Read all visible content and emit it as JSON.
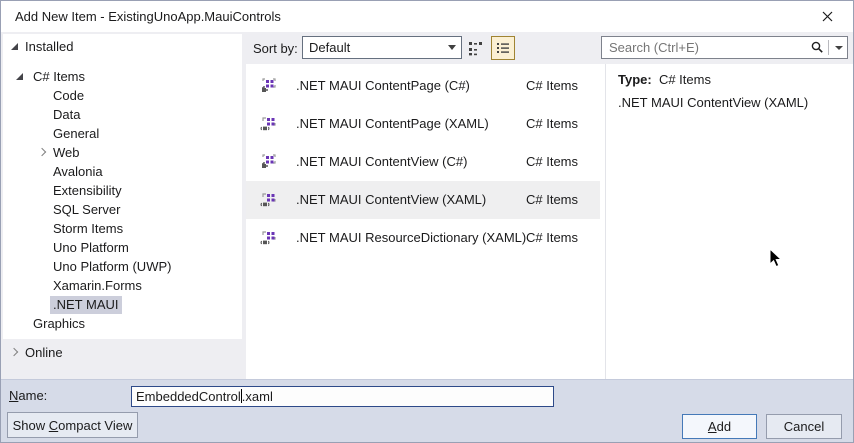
{
  "window": {
    "title": "Add New Item - ExistingUnoApp.MauiControls"
  },
  "sidebar": {
    "items": [
      {
        "label": "Installed"
      },
      {
        "label": "C# Items"
      },
      {
        "label": "Code"
      },
      {
        "label": "Data"
      },
      {
        "label": "General"
      },
      {
        "label": "Web"
      },
      {
        "label": "Avalonia"
      },
      {
        "label": "Extensibility"
      },
      {
        "label": "SQL Server"
      },
      {
        "label": "Storm Items"
      },
      {
        "label": "Uno Platform"
      },
      {
        "label": "Uno Platform (UWP)"
      },
      {
        "label": "Xamarin.Forms"
      },
      {
        "label": ".NET MAUI"
      },
      {
        "label": "Graphics"
      },
      {
        "label": "Online"
      }
    ],
    "selected_item": ".NET MAUI"
  },
  "toolbar": {
    "sort_label": "Sort by:",
    "sort_value": "Default",
    "view_small_icons": "small-icons-view",
    "view_list": "list-view"
  },
  "list": {
    "items": [
      {
        "name": ".NET MAUI ContentPage (C#)",
        "category": "C# Items",
        "icon": "maui-csharp-item-icon"
      },
      {
        "name": ".NET MAUI ContentPage (XAML)",
        "category": "C# Items",
        "icon": "maui-xaml-item-icon"
      },
      {
        "name": ".NET MAUI ContentView (C#)",
        "category": "C# Items",
        "icon": "maui-csharp-item-icon"
      },
      {
        "name": ".NET MAUI ContentView (XAML)",
        "category": "C# Items",
        "icon": "maui-xaml-item-icon"
      },
      {
        "name": ".NET MAUI ResourceDictionary (XAML)",
        "category": "C# Items",
        "icon": "maui-xaml-item-icon"
      }
    ],
    "selected_item": ".NET MAUI ContentView (XAML)"
  },
  "search": {
    "placeholder": "Search (Ctrl+E)"
  },
  "details": {
    "type_label": "Type:",
    "type_value": "C# Items",
    "description": ".NET MAUI ContentView (XAML)"
  },
  "footer": {
    "name_label": {
      "accel": "N",
      "rest": "ame:"
    },
    "name_value": "EmbeddedControl.xaml",
    "name_before_caret": "EmbeddedControl",
    "name_after_caret": ".xaml",
    "compact_button": {
      "pre": "Show ",
      "accel": "C",
      "post": "ompact View"
    },
    "add_button": {
      "accel": "A",
      "rest": "dd"
    },
    "cancel_button": "Cancel"
  },
  "colors": {
    "dialog_bg": "#EEEEF2",
    "bottom_bar_bg": "#D6DBE8",
    "tree_selection_bg": "#CCCEDB",
    "list_selection_bg": "#EFEFF0",
    "view_toggle_active_bg": "#FBF0D3",
    "view_toggle_active_border": "#A08432",
    "focused_input_border": "#2E4A89",
    "default_button_border": "#4579B8",
    "template_icon_purple": "#6A35B5"
  }
}
